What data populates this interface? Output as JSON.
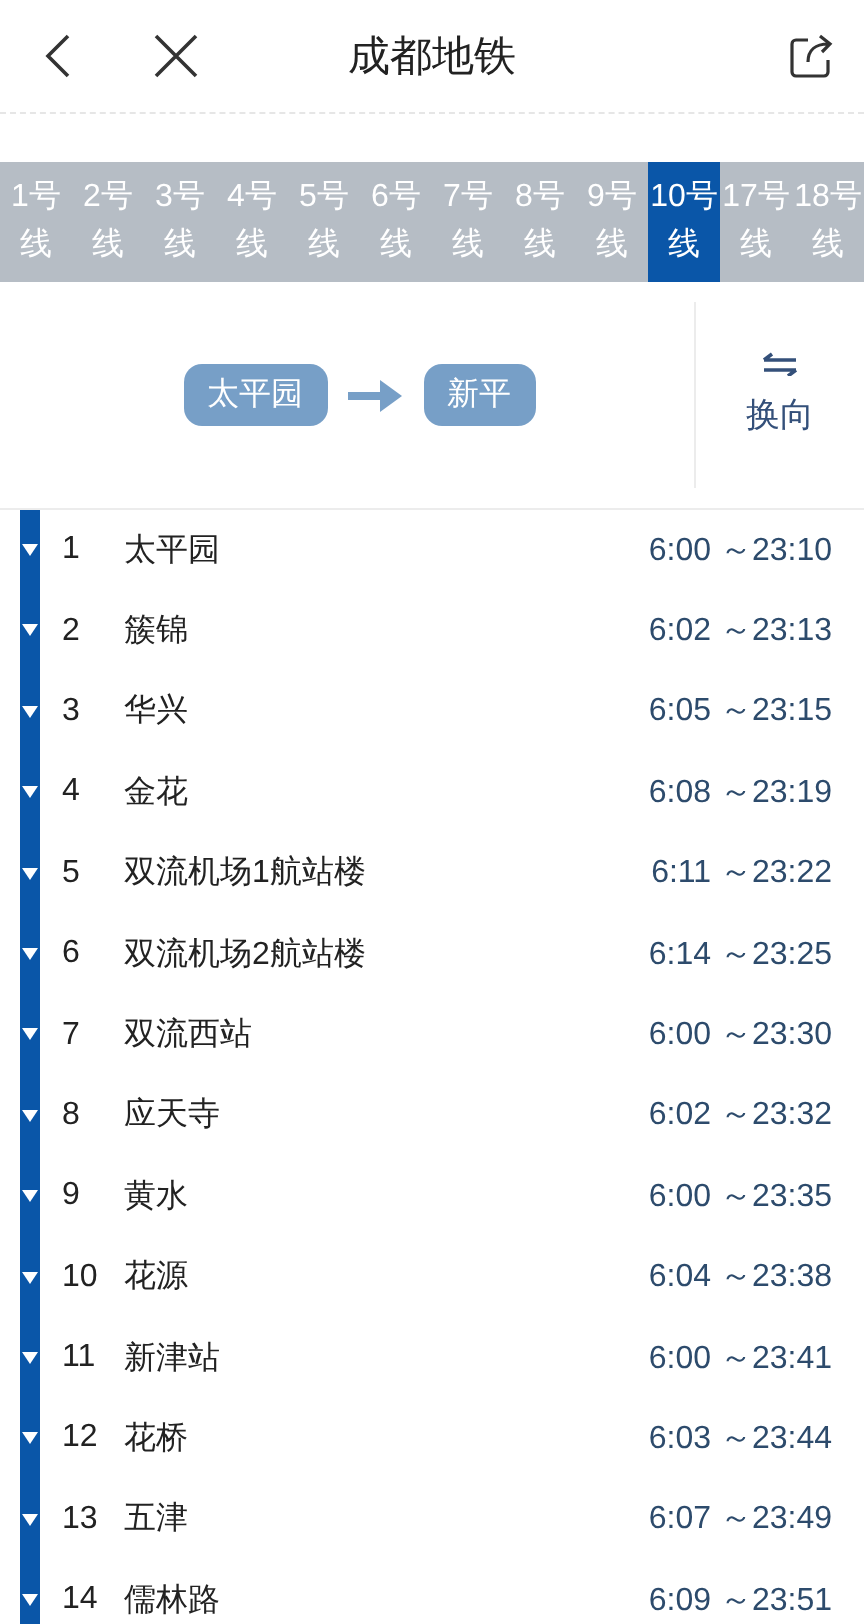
{
  "header": {
    "title": "成都地铁"
  },
  "lines": [
    {
      "label": "1号线",
      "selected": false
    },
    {
      "label": "2号线",
      "selected": false
    },
    {
      "label": "3号线",
      "selected": false
    },
    {
      "label": "4号线",
      "selected": false
    },
    {
      "label": "5号线",
      "selected": false
    },
    {
      "label": "6号线",
      "selected": false
    },
    {
      "label": "7号线",
      "selected": false
    },
    {
      "label": "8号线",
      "selected": false
    },
    {
      "label": "9号线",
      "selected": false
    },
    {
      "label": "10号线",
      "selected": true
    },
    {
      "label": "17号线",
      "selected": false
    },
    {
      "label": "18号线",
      "selected": false
    }
  ],
  "direction": {
    "from": "太平园",
    "to": "新平",
    "swap_label": "换向"
  },
  "stations": [
    {
      "number": "1",
      "name": "太平园",
      "hours": "6:00 ～23:10"
    },
    {
      "number": "2",
      "name": "簇锦",
      "hours": "6:02 ～23:13"
    },
    {
      "number": "3",
      "name": "华兴",
      "hours": "6:05 ～23:15"
    },
    {
      "number": "4",
      "name": "金花",
      "hours": "6:08 ～23:19"
    },
    {
      "number": "5",
      "name": "双流机场1航站楼",
      "hours": "6:11 ～23:22"
    },
    {
      "number": "6",
      "name": "双流机场2航站楼",
      "hours": "6:14 ～23:25"
    },
    {
      "number": "7",
      "name": "双流西站",
      "hours": "6:00 ～23:30"
    },
    {
      "number": "8",
      "name": "应天寺",
      "hours": "6:02 ～23:32"
    },
    {
      "number": "9",
      "name": "黄水",
      "hours": "6:00 ～23:35"
    },
    {
      "number": "10",
      "name": "花源",
      "hours": "6:04 ～23:38"
    },
    {
      "number": "11",
      "name": "新津站",
      "hours": "6:00 ～23:41"
    },
    {
      "number": "12",
      "name": "花桥",
      "hours": "6:03 ～23:44"
    },
    {
      "number": "13",
      "name": "五津",
      "hours": "6:07 ～23:49"
    },
    {
      "number": "14",
      "name": "儒林路",
      "hours": "6:09 ～23:51"
    }
  ]
}
